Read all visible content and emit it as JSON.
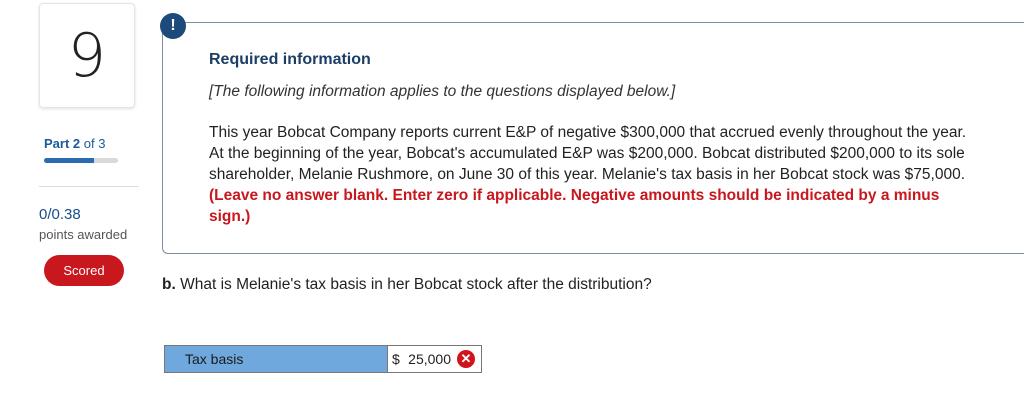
{
  "question_number": "9",
  "part": {
    "label": "Part",
    "current": "2",
    "of_text": "of 3",
    "progress_fraction": 0.67
  },
  "points": {
    "value": "0/0.38",
    "label": "points awarded"
  },
  "scored_label": "Scored",
  "info": {
    "alert_symbol": "!",
    "title": "Required information",
    "note": "[The following information applies to the questions displayed below.]",
    "body": "This year Bobcat Company reports current E&P of negative $300,000 that accrued evenly throughout the year. At the beginning of the year, Bobcat's accumulated E&P was $200,000. Bobcat distributed $200,000 to its sole shareholder, Melanie Rushmore, on June 30 of this year. Melanie's tax basis in her Bobcat stock was $75,000.",
    "instruction": "(Leave no answer blank. Enter zero if applicable. Negative amounts should be indicated by a minus sign.)"
  },
  "question": {
    "prefix": "b.",
    "text": "What is Melanie's tax basis in her Bobcat stock after the distribution?"
  },
  "answer": {
    "label": "Tax basis",
    "currency": "$",
    "value": "25,000",
    "status": "incorrect",
    "status_icon": "x-circle-icon"
  },
  "colors": {
    "accent": "#1c4a7a",
    "error": "#c8171d",
    "label_cell": "#6fa8dc"
  }
}
